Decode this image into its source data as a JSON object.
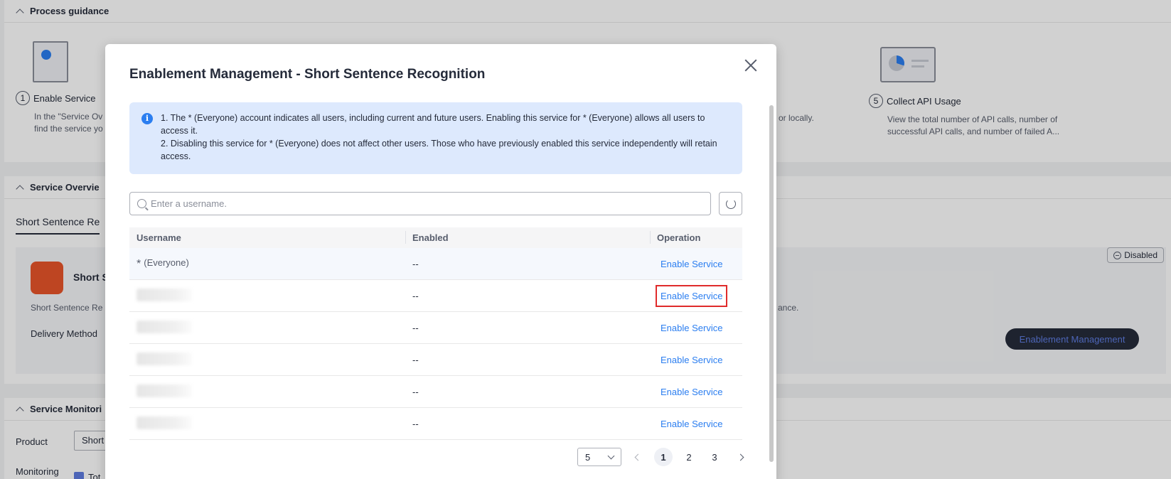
{
  "background": {
    "panel1": {
      "title": "Process guidance",
      "steps": [
        {
          "num": "1",
          "title": "Enable Service",
          "desc1": "In the \"Service Ov",
          "desc2": "find the service yo"
        },
        {
          "num": "5",
          "title": "Collect API Usage",
          "desc1": "View the total number of API calls, number of",
          "desc2": "successful API calls, and number of failed A..."
        }
      ],
      "partial_text": "or locally."
    },
    "panel2": {
      "title": "Service Overvie",
      "tab": "Short Sentence Re",
      "service_name": "Short S",
      "service_desc": "Short Sentence Re",
      "service_desc_tail": "ance.",
      "delivery_label": "Delivery Method",
      "status": "Disabled",
      "enable_mgmt_button": "Enablement Management"
    },
    "panel3": {
      "title": "Service Monitori",
      "product_label": "Product",
      "product_value": "Short",
      "monitoring_label": "Monitoring",
      "checkbox_label": "Tot"
    }
  },
  "modal": {
    "title": "Enablement Management - Short Sentence Recognition",
    "info": {
      "line1": "1. The * (Everyone) account indicates all users, including current and future users. Enabling this service for * (Everyone) allows all users to access it.",
      "line2": "2. Disabling this service for * (Everyone) does not affect other users. Those who have previously enabled this service independently will retain access."
    },
    "search": {
      "placeholder": "Enter a username."
    },
    "table": {
      "headers": [
        "Username",
        "Enabled",
        "Operation"
      ],
      "rows": [
        {
          "star": "*",
          "username": "(Everyone)",
          "enabled": "--",
          "action": "Enable Service"
        },
        {
          "username": "",
          "enabled": "--",
          "action": "Enable Service"
        },
        {
          "username": "",
          "enabled": "--",
          "action": "Enable Service"
        },
        {
          "username": "",
          "enabled": "--",
          "action": "Enable Service"
        },
        {
          "username": "",
          "enabled": "--",
          "action": "Enable Service"
        },
        {
          "username": "",
          "enabled": "--",
          "action": "Enable Service"
        }
      ]
    },
    "pagination": {
      "page_size": "5",
      "pages": [
        "1",
        "2",
        "3"
      ],
      "current": "1"
    }
  },
  "colors": {
    "link": "#2b7ef0",
    "highlight": "#e02b2b",
    "info_bg": "#dde9fd",
    "brand_icon": "#e8552a"
  }
}
